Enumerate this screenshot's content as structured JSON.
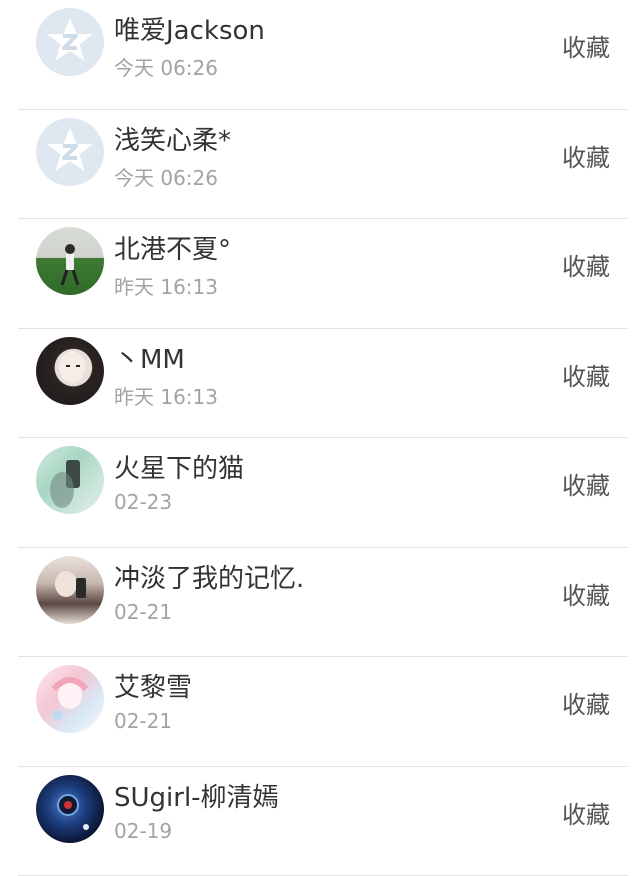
{
  "favorite_label": "收藏",
  "contacts": [
    {
      "name": "唯爱Jackson",
      "time": "今天 06:26",
      "avatar": "qq-default-avatar"
    },
    {
      "name": "浅笑心柔*",
      "time": "今天 06:26",
      "avatar": "qq-default-avatar"
    },
    {
      "name": "北港不夏°",
      "time": "昨天 16:13",
      "avatar": "photo"
    },
    {
      "name": "丶MM",
      "time": "昨天 16:13",
      "avatar": "photo"
    },
    {
      "name": "火星下的猫",
      "time": "02-23",
      "avatar": "photo"
    },
    {
      "name": "冲淡了我的记忆.",
      "time": "02-21",
      "avatar": "photo"
    },
    {
      "name": "艾黎雪",
      "time": "02-21",
      "avatar": "photo"
    },
    {
      "name": "SUgirl-柳清嫣",
      "time": "02-19",
      "avatar": "photo"
    }
  ]
}
